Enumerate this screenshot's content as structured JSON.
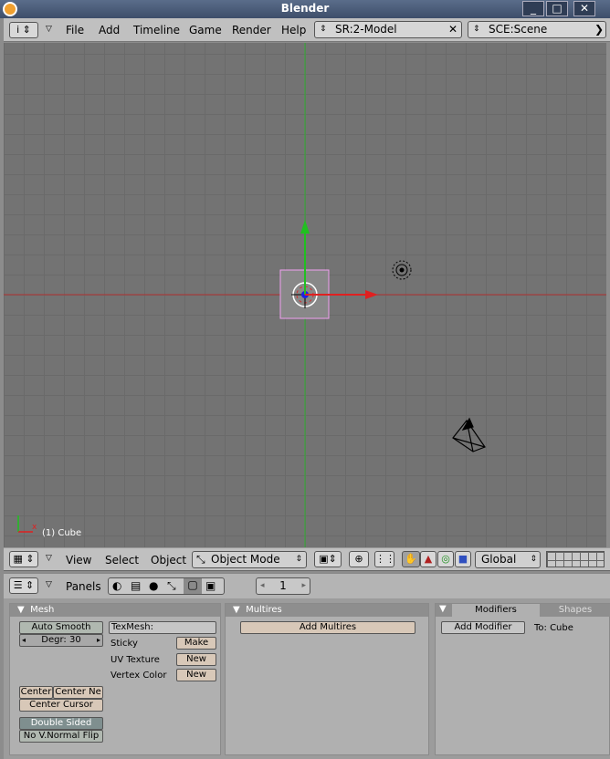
{
  "window": {
    "title": "Blender"
  },
  "topbar": {
    "menus": [
      "File",
      "Add",
      "Timeline",
      "Game",
      "Render",
      "Help"
    ],
    "screen": "SR:2-Model",
    "scene": "SCE:Scene"
  },
  "viewport": {
    "object_label": "(1) Cube"
  },
  "viewheader": {
    "menus": [
      "View",
      "Select",
      "Object"
    ],
    "mode": "Object Mode",
    "orientation": "Global"
  },
  "buttons_header": {
    "panels_label": "Panels",
    "frame": "1"
  },
  "mesh_panel": {
    "title": "Mesh",
    "auto_smooth": "Auto Smooth",
    "degr": "Degr: 30",
    "texmesh": "TexMesh:",
    "sticky": "Sticky",
    "make": "Make",
    "uv_texture": "UV Texture",
    "uv_new": "New",
    "vertex_color": "Vertex Color",
    "vc_new": "New",
    "center": "Center",
    "center_new": "Center Ne",
    "center_cursor": "Center Cursor",
    "double_sided": "Double Sided",
    "no_vnormal_flip": "No V.Normal Flip"
  },
  "multires_panel": {
    "title": "Multires",
    "add_multires": "Add Multires"
  },
  "modifiers_panel": {
    "tab_modifiers": "Modifiers",
    "tab_shapes": "Shapes",
    "add_modifier": "Add Modifier",
    "to": "To: Cube"
  }
}
